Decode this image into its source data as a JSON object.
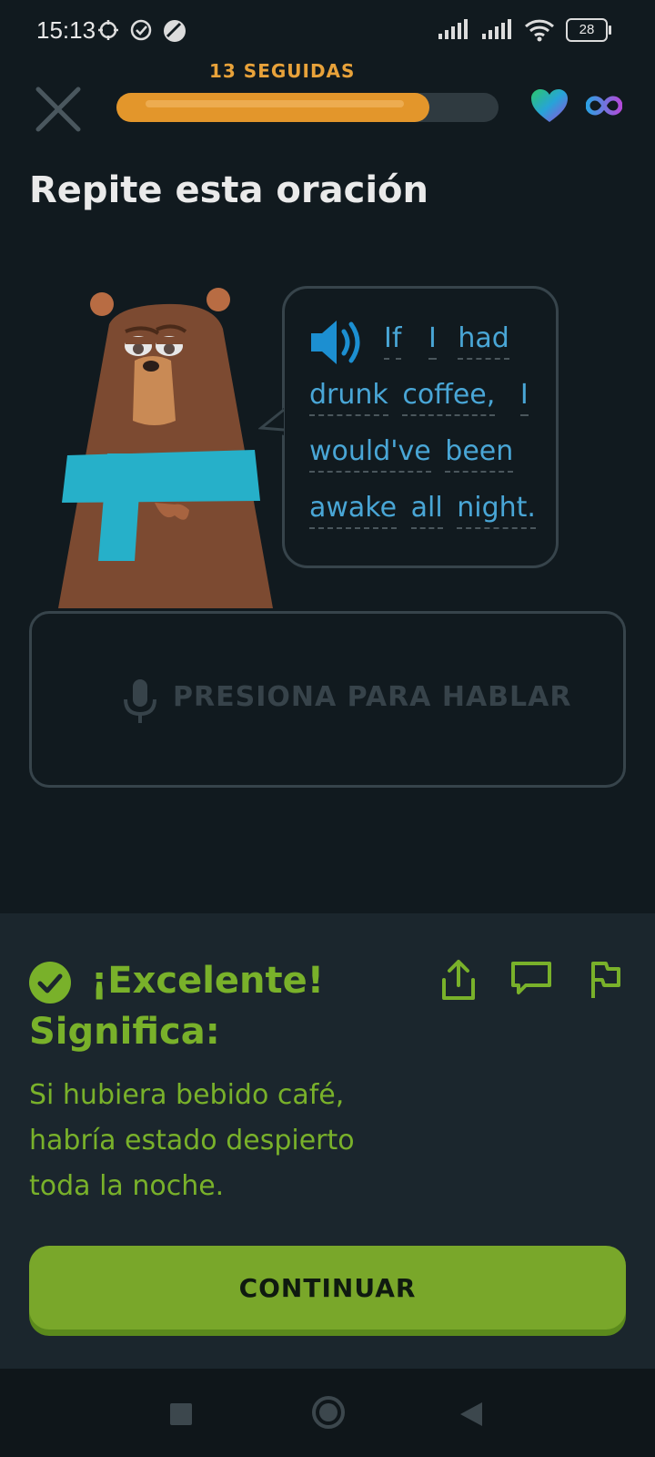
{
  "status_bar": {
    "time": "15:13",
    "battery": "28"
  },
  "lesson": {
    "streak_label": "13 SEGUIDAS",
    "progress": 0.82,
    "title": "Repite esta oración"
  },
  "prompt": {
    "lines": [
      [
        "If",
        "I",
        "had"
      ],
      [
        "drunk",
        "coffee,",
        "I"
      ],
      [
        "would've",
        "been"
      ],
      [
        "awake",
        "all",
        "night."
      ]
    ]
  },
  "mic": {
    "label": "PRESIONA PARA HABLAR"
  },
  "feedback": {
    "result": "¡Excelente!",
    "meaning_label": "Significa:",
    "meaning_text": "Si hubiera bebido café, habría estado despierto toda la noche."
  },
  "continue_label": "CONTINUAR",
  "colors": {
    "background": "#111a1f",
    "panel": "#1b262d",
    "accent_green": "#79b12a",
    "streak_orange": "#e3962b",
    "prompt_blue": "#49a6d6"
  },
  "icons": [
    "close-icon",
    "heart-icon",
    "infinity-icon",
    "speaker-icon",
    "microphone-icon",
    "check-circle-icon",
    "share-icon",
    "comment-icon",
    "flag-icon"
  ]
}
